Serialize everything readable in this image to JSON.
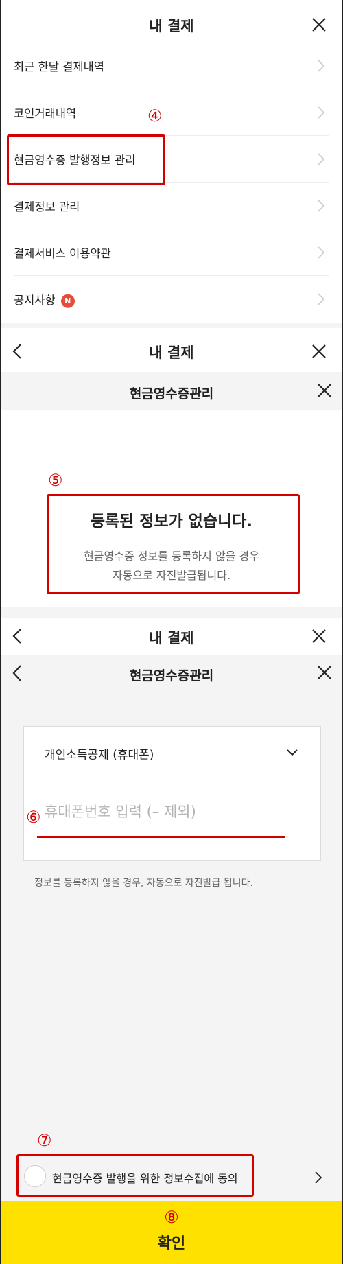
{
  "screen1": {
    "title": "내 결제",
    "menu": [
      {
        "label": "최근 한달 결제내역"
      },
      {
        "label": "코인거래내역"
      },
      {
        "label": "현금영수증 발행정보 관리"
      },
      {
        "label": "결제정보 관리"
      },
      {
        "label": "결제서비스 이용약관"
      },
      {
        "label": "공지사항",
        "badge": "N"
      }
    ],
    "step_marker": "④"
  },
  "screen2": {
    "header_title": "내 결제",
    "modal_title": "현금영수증관리",
    "step_marker": "⑤",
    "empty_title": "등록된 정보가 없습니다.",
    "empty_desc_line1": "현금영수증 정보를 등록하지 않을 경우",
    "empty_desc_line2": "자동으로 자진발급됩니다."
  },
  "screen3": {
    "header_title": "내 결제",
    "modal_title": "현금영수증관리",
    "select_value": "개인소득공제 (휴대폰)",
    "step_input": "⑥",
    "phone_placeholder": "휴대폰번호 입력 (– 제외)",
    "hint": "정보를 등록하지 않을 경우, 자동으로 자진발급 됩니다.",
    "step_agree": "⑦",
    "agree_label": "현금영수증 발행을 위한 정보수집에 동의",
    "step_confirm": "⑧",
    "confirm_label": "확인"
  },
  "colors": {
    "accent_yellow": "#ffe100",
    "annotation_red": "#d40000",
    "badge_red": "#e84a3b"
  },
  "icons": [
    "close-icon",
    "back-icon",
    "chevron-right-icon",
    "chevron-down-icon"
  ]
}
